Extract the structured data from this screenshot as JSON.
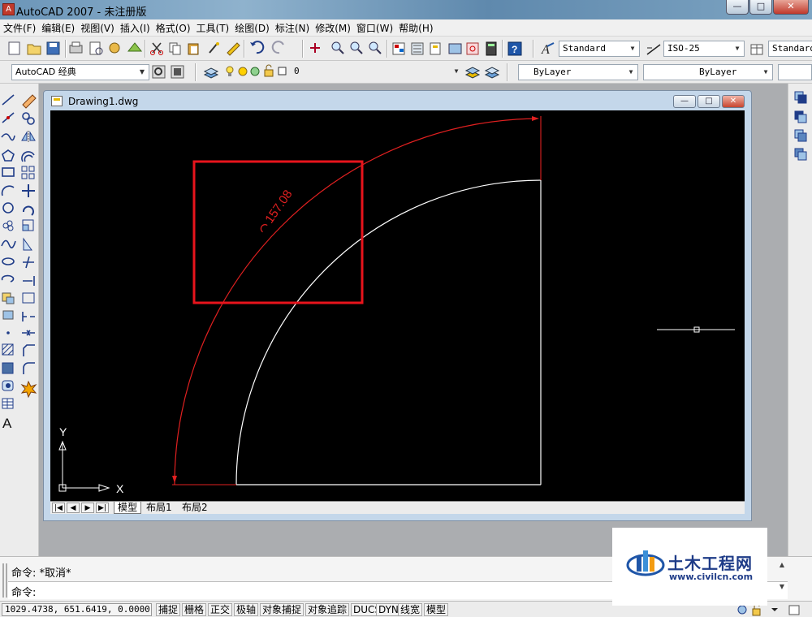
{
  "window": {
    "title": "AutoCAD 2007 - 未注册版",
    "minimize": "—",
    "maximize": "□",
    "close": "✕"
  },
  "menu": [
    "文件(F)",
    "编辑(E)",
    "视图(V)",
    "插入(I)",
    "格式(O)",
    "工具(T)",
    "绘图(D)",
    "标注(N)",
    "修改(M)",
    "窗口(W)",
    "帮助(H)"
  ],
  "toolbar": {
    "text_style": "Standard",
    "dim_style": "ISO-25",
    "table_style": "Standard",
    "workspace": "AutoCAD 经典",
    "layer": "0",
    "color": "ByLayer",
    "linetype": "ByLayer"
  },
  "document": {
    "title": "Drawing1.dwg",
    "tabs": [
      "模型",
      "布局1",
      "布局2"
    ],
    "active_tab": "模型",
    "dimension_text": "157.08",
    "ucs_x": "X",
    "ucs_y": "Y"
  },
  "command": {
    "history": "命令: *取消*",
    "prompt": "命令:"
  },
  "status": {
    "coords": "1029.4738, 651.6419, 0.0000",
    "buttons": [
      "捕捉",
      "栅格",
      "正交",
      "极轴",
      "对象捕捉",
      "对象追踪",
      "DUCS",
      "DYN",
      "线宽",
      "模型"
    ]
  },
  "watermark": {
    "title": "土木工程网",
    "url": "www.civilcn.com"
  },
  "colors": {
    "dimension": "#e02020",
    "geometry": "#ffffff",
    "highlight_box": "#e8141c",
    "canvas": "#000000"
  }
}
